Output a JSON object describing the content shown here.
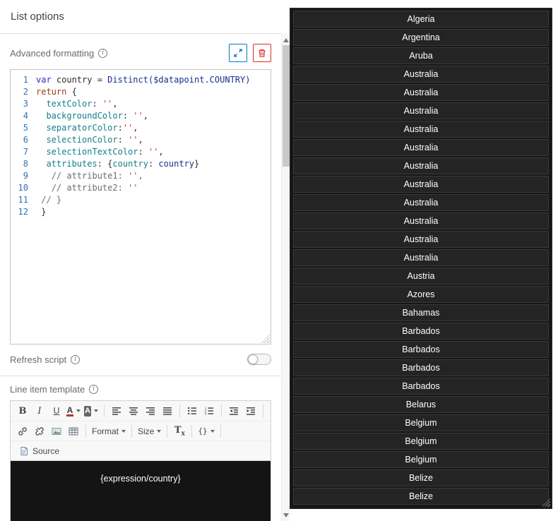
{
  "colors": {
    "accent_blue": "#0079c1",
    "danger_red": "#d83020",
    "list_bg": "#161616",
    "row_bg": "#242424",
    "row_border": "#3a3a3a",
    "canvas_bg": "#141414"
  },
  "panel": {
    "title": "List options",
    "advanced_formatting": {
      "label": "Advanced formatting"
    },
    "code_editor": {
      "lines": [
        {
          "n": "1",
          "tokens": [
            {
              "t": "var",
              "c": "kw"
            },
            {
              "t": " country = ",
              "c": "pl"
            },
            {
              "t": "Distinct($datapoint.COUNTRY)",
              "c": "mem"
            }
          ]
        },
        {
          "n": "2",
          "tokens": [
            {
              "t": "return",
              "c": "ret"
            },
            {
              "t": " {",
              "c": "pl"
            }
          ]
        },
        {
          "n": "3",
          "tokens": [
            {
              "t": "  ",
              "c": "pl"
            },
            {
              "t": "textColor",
              "c": "prop"
            },
            {
              "t": ": ",
              "c": "pl"
            },
            {
              "t": "''",
              "c": "str"
            },
            {
              "t": ",",
              "c": "pl"
            }
          ]
        },
        {
          "n": "4",
          "tokens": [
            {
              "t": "  ",
              "c": "pl"
            },
            {
              "t": "backgroundColor",
              "c": "prop"
            },
            {
              "t": ": ",
              "c": "pl"
            },
            {
              "t": "''",
              "c": "str"
            },
            {
              "t": ",",
              "c": "pl"
            }
          ]
        },
        {
          "n": "5",
          "tokens": [
            {
              "t": "  ",
              "c": "pl"
            },
            {
              "t": "separatorColor",
              "c": "prop"
            },
            {
              "t": ":",
              "c": "pl"
            },
            {
              "t": "''",
              "c": "str"
            },
            {
              "t": ",",
              "c": "pl"
            }
          ]
        },
        {
          "n": "6",
          "tokens": [
            {
              "t": "  ",
              "c": "pl"
            },
            {
              "t": "selectionColor",
              "c": "prop"
            },
            {
              "t": ": ",
              "c": "pl"
            },
            {
              "t": "''",
              "c": "str"
            },
            {
              "t": ",",
              "c": "pl"
            }
          ]
        },
        {
          "n": "7",
          "tokens": [
            {
              "t": "  ",
              "c": "pl"
            },
            {
              "t": "selectionTextColor",
              "c": "prop"
            },
            {
              "t": ": ",
              "c": "pl"
            },
            {
              "t": "''",
              "c": "str"
            },
            {
              "t": ",",
              "c": "pl"
            }
          ]
        },
        {
          "n": "8",
          "tokens": [
            {
              "t": "  ",
              "c": "pl"
            },
            {
              "t": "attributes",
              "c": "prop"
            },
            {
              "t": ": {",
              "c": "pl"
            },
            {
              "t": "country",
              "c": "prop"
            },
            {
              "t": ": ",
              "c": "pl"
            },
            {
              "t": "country",
              "c": "mem"
            },
            {
              "t": "}",
              "c": "pl"
            }
          ]
        },
        {
          "n": "9",
          "tokens": [
            {
              "t": "   ",
              "c": "pl"
            },
            {
              "t": "// attribute1: '',",
              "c": "com"
            }
          ]
        },
        {
          "n": "10",
          "tokens": [
            {
              "t": "   ",
              "c": "pl"
            },
            {
              "t": "// attribute2: ''",
              "c": "com"
            }
          ]
        },
        {
          "n": "11",
          "tokens": [
            {
              "t": " ",
              "c": "pl"
            },
            {
              "t": "// }",
              "c": "com"
            }
          ]
        },
        {
          "n": "12",
          "tokens": [
            {
              "t": " ",
              "c": "pl"
            },
            {
              "t": "}",
              "c": "pl"
            }
          ]
        }
      ]
    },
    "refresh_script": {
      "label": "Refresh script",
      "toggle_state": "off"
    },
    "line_item_template": {
      "label": "Line item template"
    },
    "rte": {
      "toolbar": {
        "bold": "B",
        "italic": "I",
        "underline": "U",
        "text_color_letter": "A",
        "bg_color_letter": "A",
        "format_label": "Format",
        "size_label": "Size",
        "remove_format_main": "T",
        "remove_format_sub": "x",
        "templates_label": "{}",
        "source_label": "Source"
      },
      "preview_text": "{expression/country}"
    }
  },
  "preview_list": {
    "items": [
      "Algeria",
      "Argentina",
      "Aruba",
      "Australia",
      "Australia",
      "Australia",
      "Australia",
      "Australia",
      "Australia",
      "Australia",
      "Australia",
      "Australia",
      "Australia",
      "Australia",
      "Austria",
      "Azores",
      "Bahamas",
      "Barbados",
      "Barbados",
      "Barbados",
      "Barbados",
      "Belarus",
      "Belgium",
      "Belgium",
      "Belgium",
      "Belize",
      "Belize"
    ]
  }
}
